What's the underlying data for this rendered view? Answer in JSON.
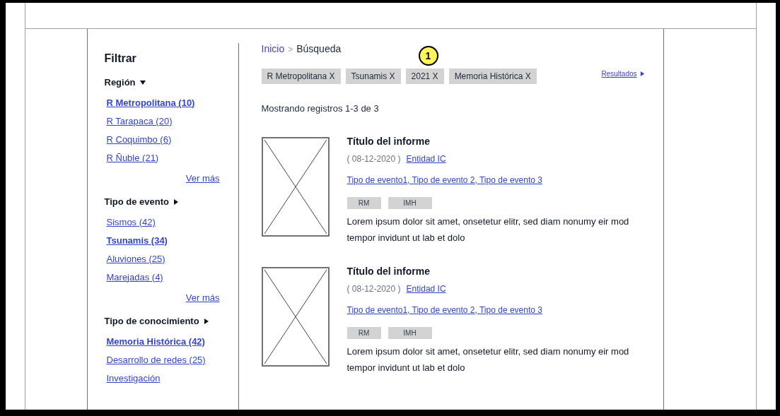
{
  "sidebar": {
    "title": "Filtrar",
    "groups": [
      {
        "heading": "Región",
        "expanded": true,
        "items": [
          {
            "label": "R Metropolitana (10)",
            "selected": true
          },
          {
            "label": "R Tarapaca (20)",
            "selected": false
          },
          {
            "label": "R Coquimbo (6)",
            "selected": false
          },
          {
            "label": "R Ñuble (21)",
            "selected": false
          }
        ],
        "more": "Ver más"
      },
      {
        "heading": "Tipo de evento",
        "expanded": false,
        "items": [
          {
            "label": "Sismos (42)",
            "selected": false
          },
          {
            "label": "Tsunamis (34)",
            "selected": true
          },
          {
            "label": "Aluviones (25)",
            "selected": false
          },
          {
            "label": "Marejadas (4)",
            "selected": false
          }
        ],
        "more": "Ver más"
      },
      {
        "heading": "Tipo de conocimiento",
        "expanded": false,
        "items": [
          {
            "label": "Memoria Histórica (42)",
            "selected": true
          },
          {
            "label": "Desarrollo de redes (25)",
            "selected": false
          },
          {
            "label": "Investigación",
            "selected": false
          }
        ]
      }
    ]
  },
  "breadcrumb": {
    "home": "Inicio",
    "separator": ">",
    "current": "Búsqueda"
  },
  "annotation": {
    "label": "1"
  },
  "filter_chips": [
    "R Metropolitana X",
    "Tsunamis X",
    "2021 X",
    "Memoria Histórica X"
  ],
  "results_link": "Resultados",
  "summary": "Mostrando registros 1-3 de 3",
  "results": [
    {
      "title": "Título del informe",
      "date": "( 08-12-2020 )",
      "entity": "Entidad IC",
      "event_types": "Tipo de evento1, Tipo de evento 2, Tipo de evento 3",
      "tags": [
        "RM",
        "IMH"
      ],
      "description": "Lorem ipsum dolor sit amet, onsetetur  elitr, sed diam nonumy eir mod tempor invidunt ut  lab  et dolo"
    },
    {
      "title": "Título del informe",
      "date": "( 08-12-2020 )",
      "entity": "Entidad IC",
      "event_types": "Tipo de evento1, Tipo de evento 2, Tipo de evento 3",
      "tags": [
        "RM",
        "IMH"
      ],
      "description": "Lorem ipsum dolor sit amet, onsetetur  elitr, sed diam nonumy eir mod tempor invidunt ut  lab  et dolo"
    }
  ]
}
